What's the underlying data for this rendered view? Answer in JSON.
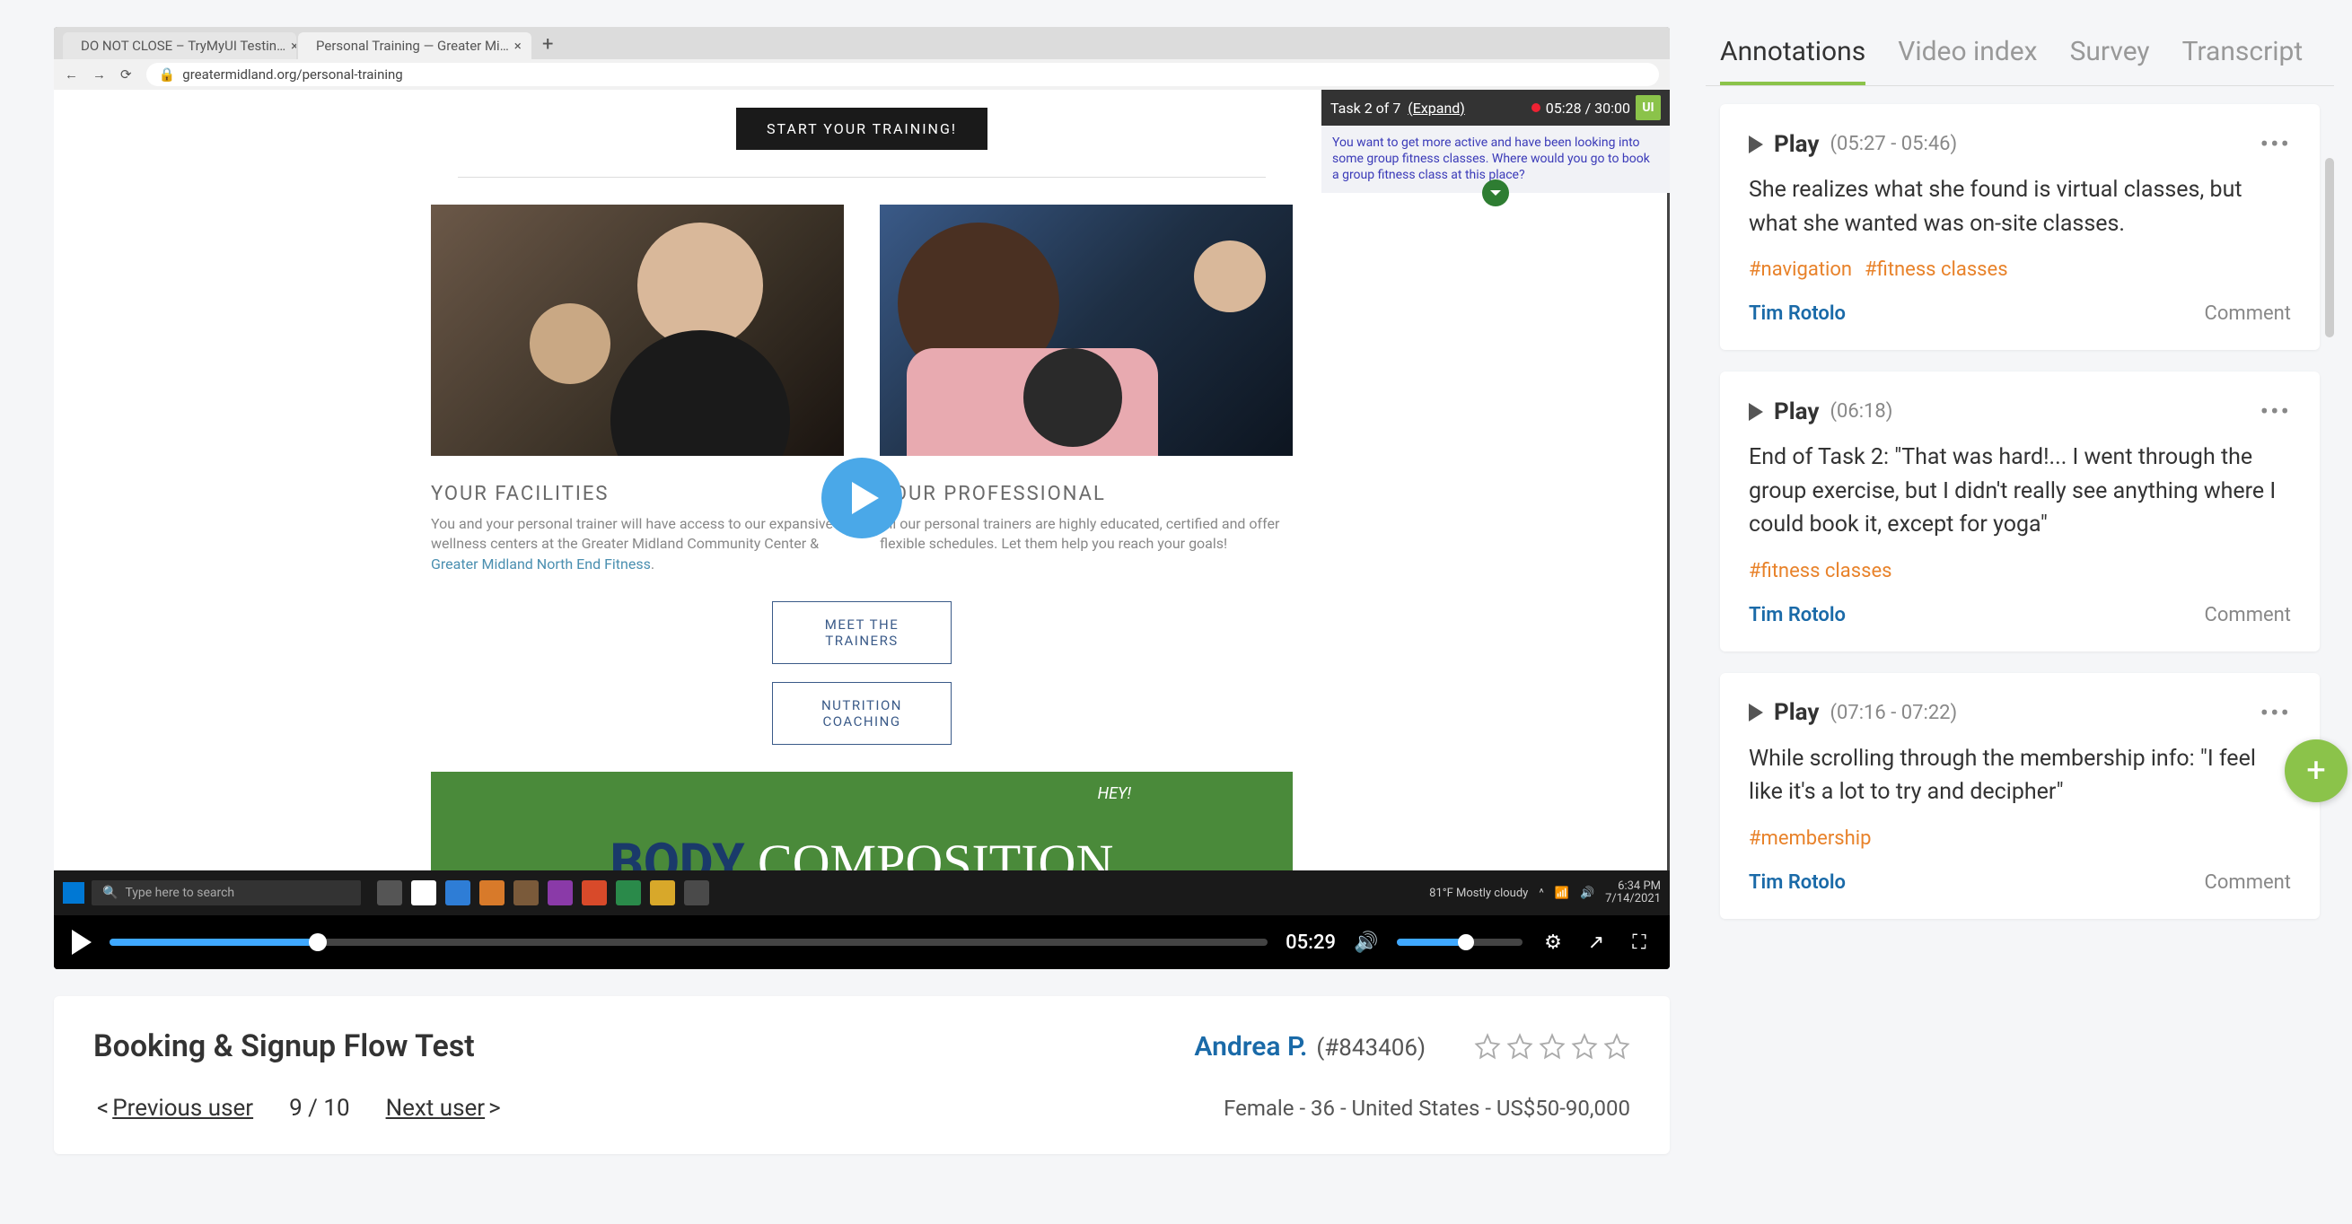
{
  "browser": {
    "tabs": [
      {
        "title": "DO NOT CLOSE – TryMyUI Testin…",
        "favicon": "#8bc34a"
      },
      {
        "title": "Personal Training — Greater Mi…",
        "favicon": "#555"
      }
    ],
    "url": "greatermidland.org/personal-training"
  },
  "recorder": {
    "task_label": "Task 2 of 7",
    "expand": "(Expand)",
    "timer": "05:28 / 30:00",
    "logo": "UI",
    "prompt": "You want to get more active and have been looking into some group fitness classes. Where would you go to book a group fitness class at this place?"
  },
  "page": {
    "start_btn": "START YOUR TRAINING!",
    "left_heading": "YOUR FACILITIES",
    "left_text_a": "You and your personal trainer will have access to our expansive wellness centers at the Greater Midland Community Center & ",
    "left_link": "Greater Midland North End Fitness",
    "right_heading": "YOUR PROFESSIONAL",
    "right_text": "All our personal trainers are highly educated, certified and offer flexible schedules. Let them help you reach your goals!",
    "btn_trainers": "MEET THE TRAINERS",
    "btn_nutrition": "NUTRITION COACHING",
    "body": "BODY",
    "composition": "COMPOSITION",
    "hey": "HEY!"
  },
  "taskbar": {
    "search_ph": "Type here to search",
    "weather": "81°F  Mostly cloudy",
    "time": "6:34 PM",
    "date": "7/14/2021"
  },
  "player": {
    "time": "05:29"
  },
  "info": {
    "title": "Booking & Signup Flow Test",
    "user_name": "Andrea P.",
    "user_id": "(#843406)",
    "prev": "Previous user",
    "next": "Next user",
    "counter": "9 / 10",
    "demo": "Female  -  36  -  United States  -  US$50-90,000"
  },
  "tabs": {
    "annotations": "Annotations",
    "video_index": "Video index",
    "survey": "Survey",
    "transcript": "Transcript"
  },
  "annotations": [
    {
      "play": "Play",
      "time": "(05:27 - 05:46)",
      "body": "She realizes what she found is virtual classes, but what she wanted was on-site classes.",
      "tags": [
        "#navigation",
        "#fitness classes"
      ],
      "author": "Tim Rotolo",
      "comment": "Comment"
    },
    {
      "play": "Play",
      "time": "(06:18)",
      "body": "End of Task 2: \"That was hard!... I went through the group exercise, but I didn't really see anything where I could book it, except for yoga\"",
      "tags": [
        "#fitness classes"
      ],
      "author": "Tim Rotolo",
      "comment": "Comment"
    },
    {
      "play": "Play",
      "time": "(07:16 - 07:22)",
      "body": "While scrolling through the membership info: \"I feel like it's a lot to try and decipher\"",
      "tags": [
        "#membership"
      ],
      "author": "Tim Rotolo",
      "comment": "Comment"
    }
  ]
}
